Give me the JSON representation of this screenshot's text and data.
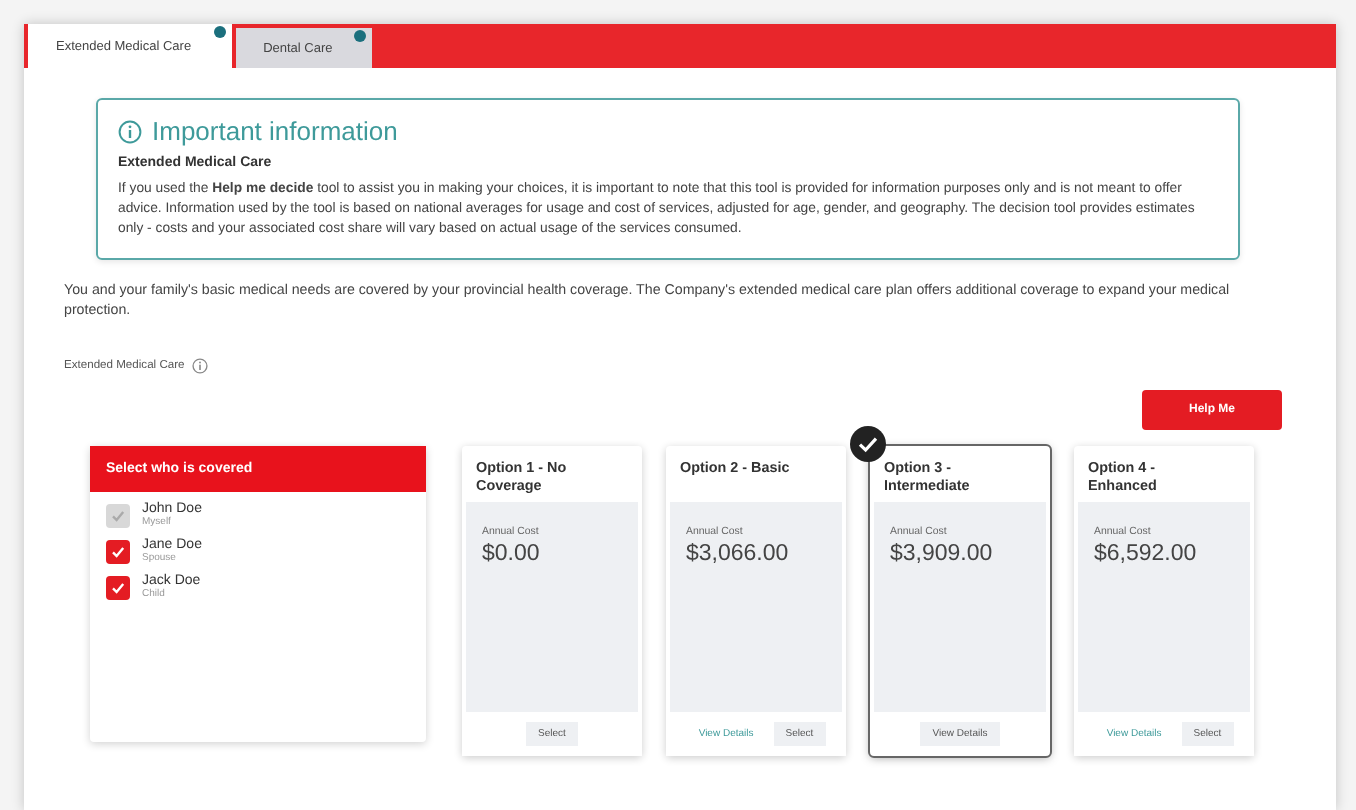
{
  "tabs": [
    {
      "label": "Extended Medical Care",
      "selected": true
    },
    {
      "label": "Dental Care",
      "selected": false
    }
  ],
  "info": {
    "title": "Important information",
    "subtitle": "Extended Medical Care",
    "text": "If you used the **Help me decide** tool to assist you in making your choices, it is important to note that this tool is provided for information purposes only and is not meant to offer advice. Information used by the tool is based on national averages for usage and cost of services, adjusted for age, gender, and geography. The decision tool provides estimates only - costs and your associated cost share will vary based on actual usage of the services consumed."
  },
  "intro": "You and your family's basic medical needs are covered by your provincial health coverage. The Company's extended medical care plan offers additional coverage to expand your medical protection.",
  "section_label": "Extended Medical Care",
  "help_button": "Help Me",
  "who_panel": {
    "title": "Select who is covered",
    "people": [
      {
        "name": "John Doe",
        "relation": "Myself",
        "checked": true,
        "disabled": true
      },
      {
        "name": "Jane Doe",
        "relation": "Spouse",
        "checked": true,
        "disabled": false
      },
      {
        "name": "Jack Doe",
        "relation": "Child",
        "checked": true,
        "disabled": false
      }
    ]
  },
  "options": [
    {
      "title": "Option 1 - No Coverage",
      "cost_label": "Annual Cost",
      "cost": "$0.00",
      "selected": false,
      "buttons": [
        "Select"
      ]
    },
    {
      "title": "Option 2 - Basic",
      "cost_label": "Annual Cost",
      "cost": "$3,066.00",
      "selected": false,
      "buttons": [
        "View Details",
        "Select"
      ]
    },
    {
      "title": "Option 3 - Intermediate",
      "cost_label": "Annual Cost",
      "cost": "$3,909.00",
      "selected": true,
      "buttons": [
        "View Details"
      ]
    },
    {
      "title": "Option 4 - Enhanced",
      "cost_label": "Annual Cost",
      "cost": "$6,592.00",
      "selected": false,
      "buttons": [
        "View Details",
        "Select"
      ]
    }
  ]
}
